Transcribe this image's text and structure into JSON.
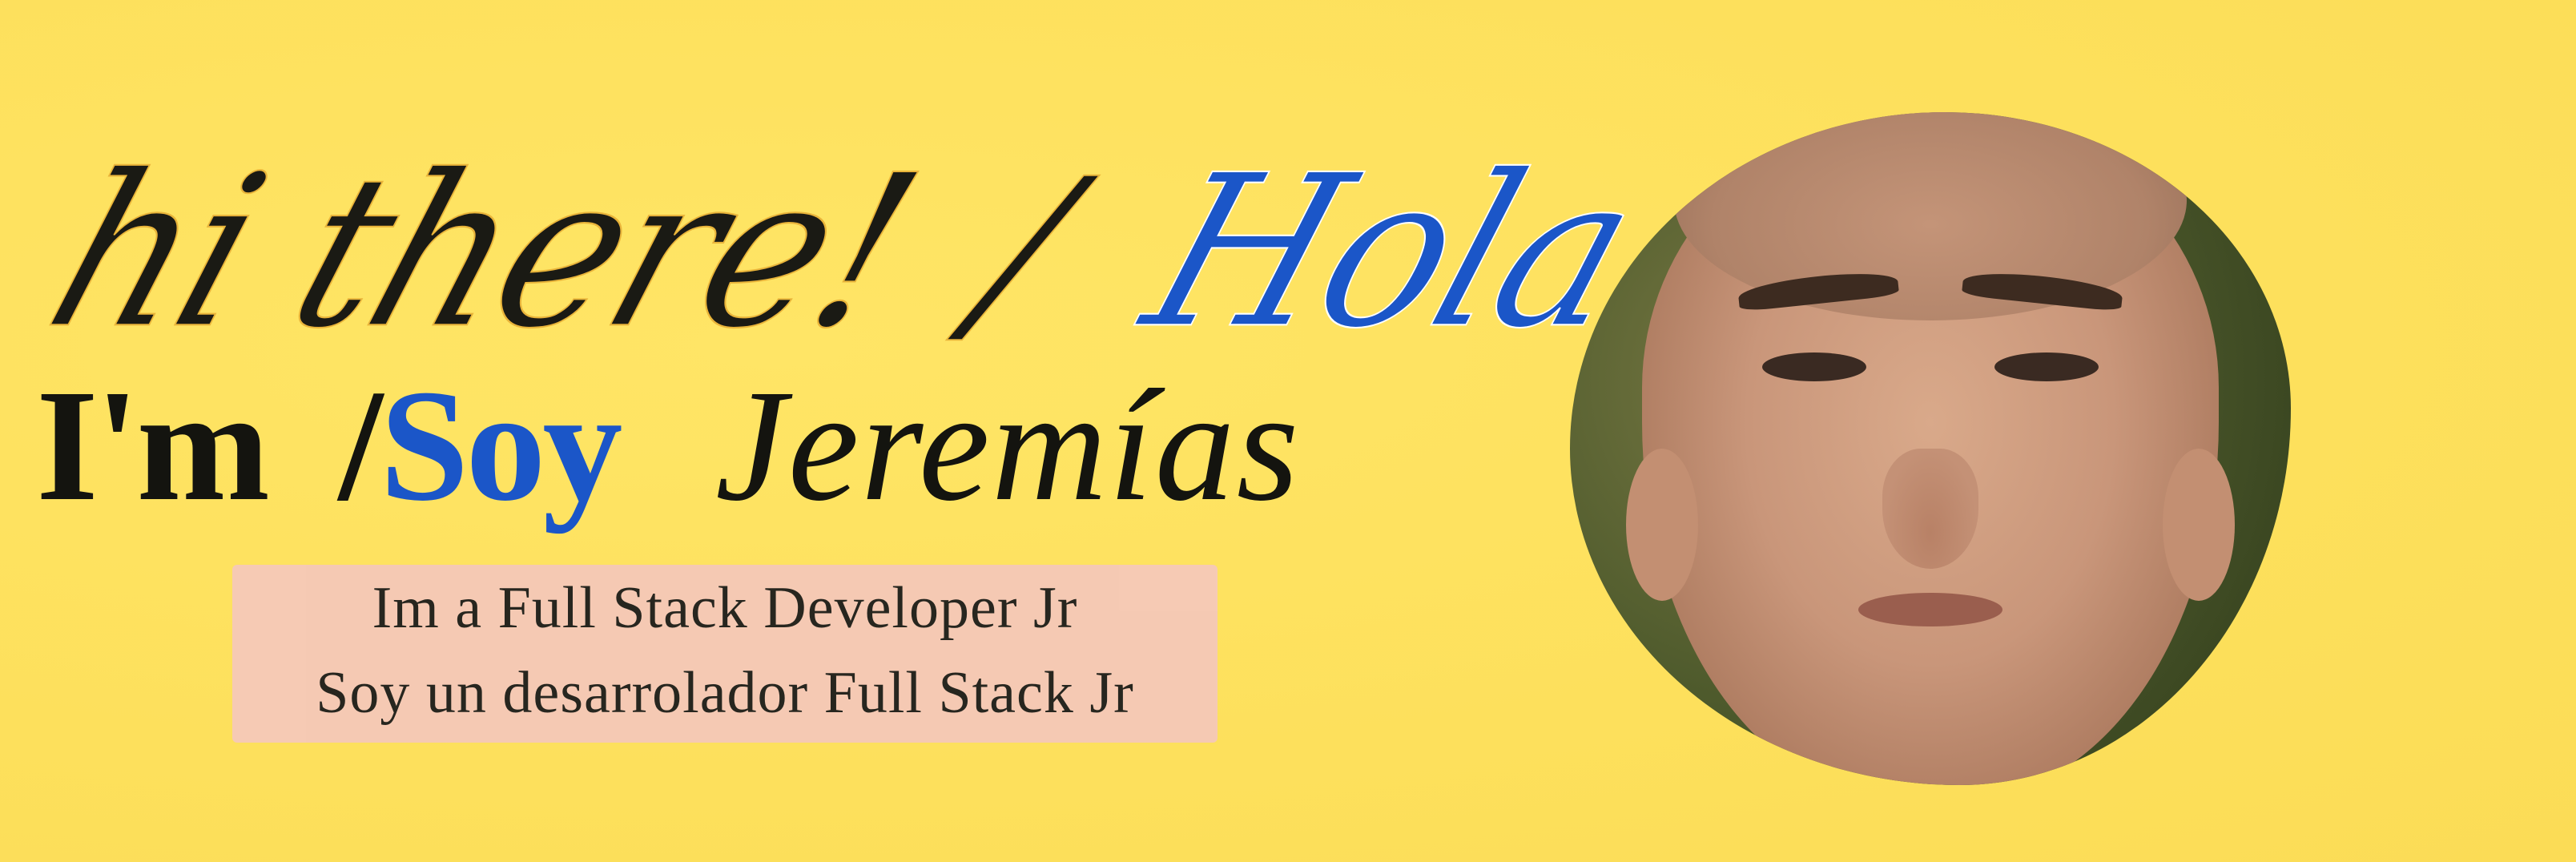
{
  "banner": {
    "greeting": {
      "english": "hi there!",
      "separator": "/",
      "spanish": "Hola"
    },
    "intro": {
      "im": "I'm",
      "slash": "/",
      "soy": "Soy",
      "name": "Jeremías"
    },
    "role": {
      "english": "Im a Full Stack Developer Jr",
      "spanish": "Soy un desarrolador Full Stack Jr"
    },
    "colors": {
      "background": "#fee15e",
      "accent_blue": "#1b56c8",
      "text_dark": "#14140f",
      "role_highlight": "#f5c8b8"
    },
    "photo": {
      "icon": "profile-photo"
    }
  }
}
